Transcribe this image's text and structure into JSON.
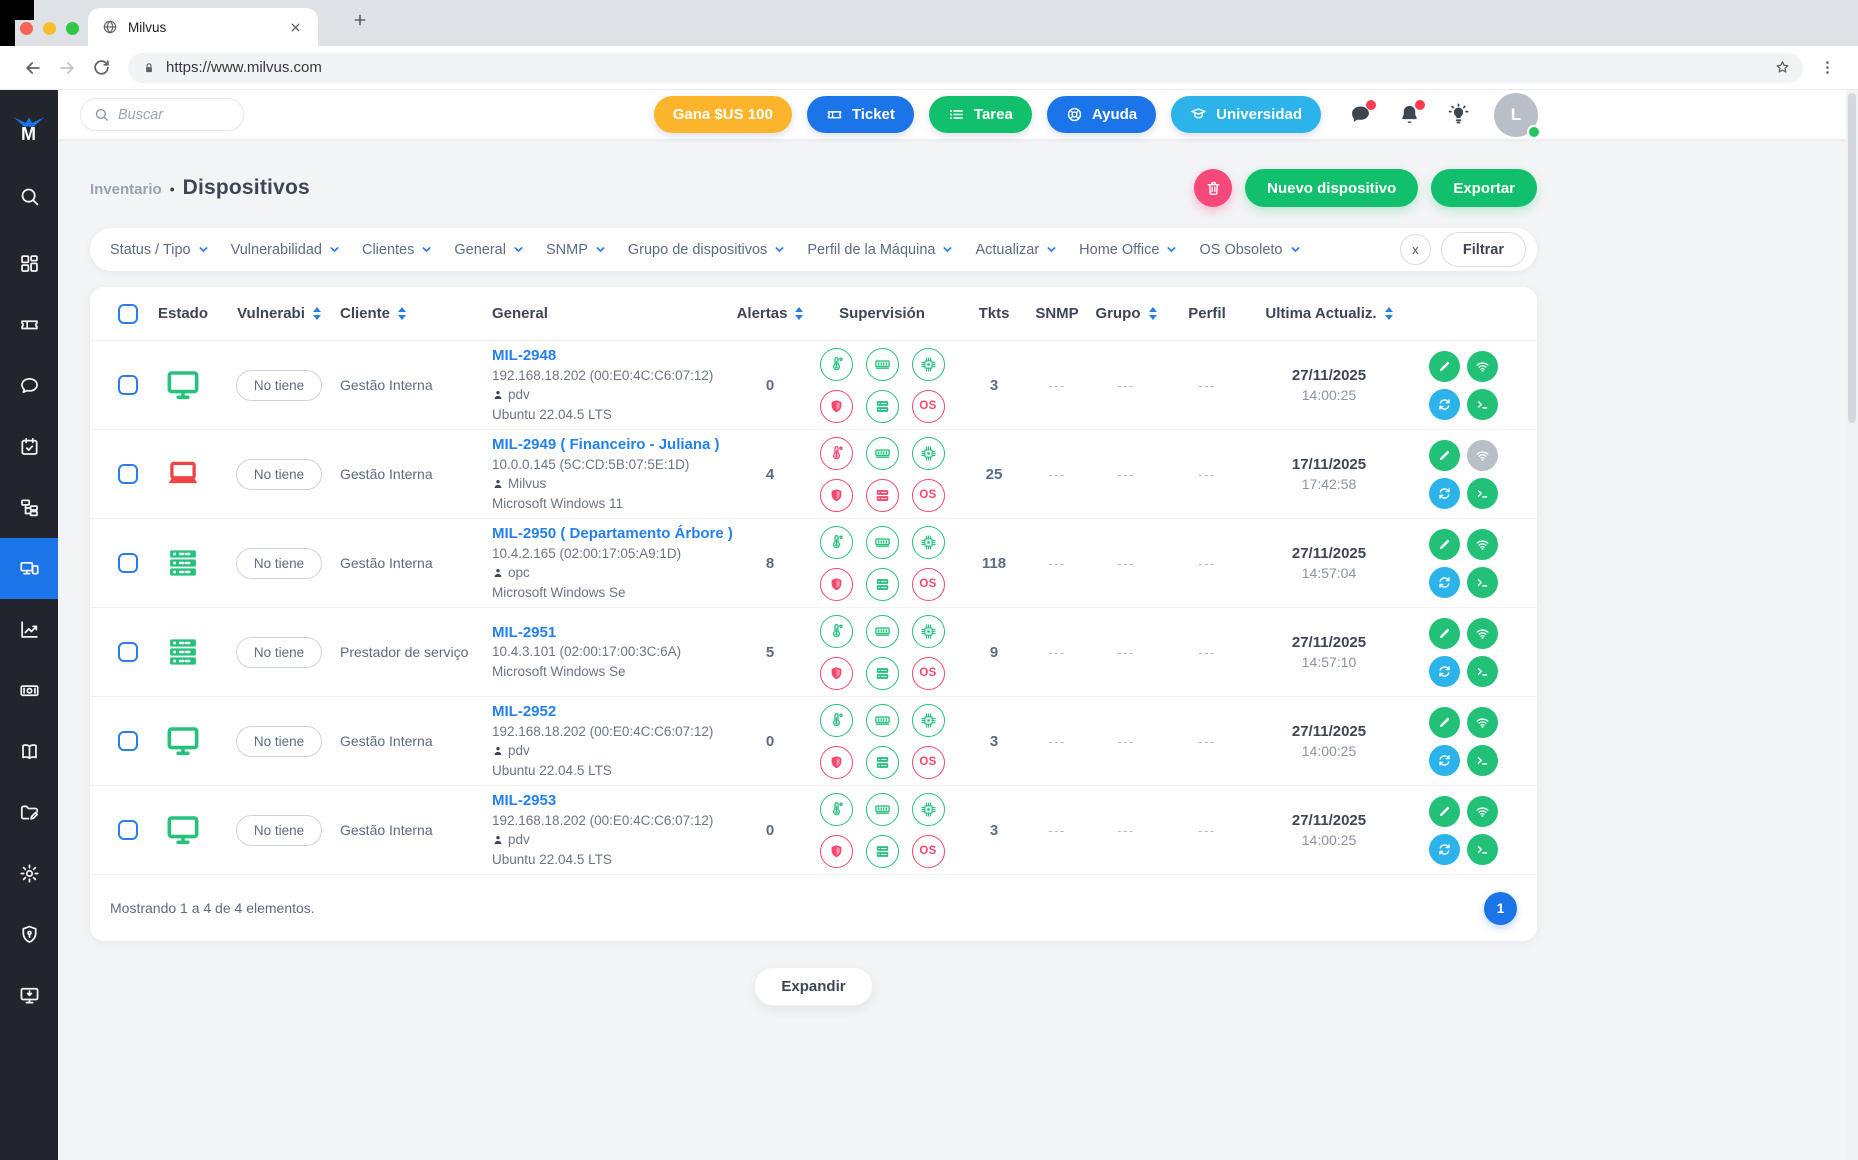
{
  "colors": {
    "green": "#12bf6c",
    "icon_green": "#27c17e",
    "pink": "#f5476e",
    "blue": "#1b74e8",
    "cyan": "#2bb3ea",
    "yellow": "#fbb42c",
    "laptop_red": "#ef4444",
    "sidebar_bg": "#22252b",
    "link_blue": "#2680eb",
    "notification_red": "#fb3c52"
  },
  "browser": {
    "tab_title": "Milvus",
    "url": "https://www.milvus.com"
  },
  "sidebar": {
    "active": "devices",
    "items": [
      {
        "name": "search"
      },
      {
        "name": "dashboard"
      },
      {
        "name": "tickets"
      },
      {
        "name": "chat"
      },
      {
        "name": "calendar"
      },
      {
        "name": "topology"
      },
      {
        "name": "devices"
      },
      {
        "name": "reports"
      },
      {
        "name": "billing"
      },
      {
        "name": "knowledge-base"
      },
      {
        "name": "projects"
      },
      {
        "name": "settings"
      },
      {
        "name": "security"
      },
      {
        "name": "remote-install"
      }
    ]
  },
  "topbar": {
    "search_placeholder": "Buscar",
    "pills": [
      {
        "id": "reward",
        "label": "Gana $US 100",
        "icon": null,
        "bg": "#fbb42c"
      },
      {
        "id": "ticket",
        "label": "Ticket",
        "icon": "ticket",
        "bg": "#1b74e8"
      },
      {
        "id": "task",
        "label": "Tarea",
        "icon": "list",
        "bg": "#12bf6c"
      },
      {
        "id": "help",
        "label": "Ayuda",
        "icon": "life-ring",
        "bg": "#1b74e8"
      },
      {
        "id": "university",
        "label": "Universidad",
        "icon": "graduation-cap",
        "bg": "#2bb3ea"
      }
    ],
    "avatar_initial": "L"
  },
  "page": {
    "breadcrumb": "Inventario",
    "separator": "•",
    "title": "Dispositivos",
    "new_device": "Nuevo dispositivo",
    "export": "Exportar"
  },
  "filters": {
    "items": [
      "Status / Tipo",
      "Vulnerabilidad",
      "Clientes",
      "General",
      "SNMP",
      "Grupo de dispositivos",
      "Perfil de la Máquina",
      "Actualizar",
      "Home Office",
      "OS Obsoleto"
    ],
    "clear": "x",
    "apply": "Filtrar"
  },
  "table": {
    "columns": [
      {
        "label": "Estado",
        "sortable": false,
        "align": "center"
      },
      {
        "label": "Vulnerabi",
        "sortable": true,
        "align": "center"
      },
      {
        "label": "Cliente",
        "sortable": true,
        "align": "left"
      },
      {
        "label": "General",
        "sortable": false,
        "align": "left"
      },
      {
        "label": "Alertas",
        "sortable": true,
        "align": "center"
      },
      {
        "label": "Supervisión",
        "sortable": false,
        "align": "center"
      },
      {
        "label": "Tkts",
        "sortable": false,
        "align": "center"
      },
      {
        "label": "SNMP",
        "sortable": false,
        "align": "center"
      },
      {
        "label": "Grupo",
        "sortable": true,
        "align": "center"
      },
      {
        "label": "Perfil",
        "sortable": false,
        "align": "center"
      },
      {
        "label": "Ultima Actualiz.",
        "sortable": true,
        "align": "center"
      }
    ],
    "rows": [
      {
        "device": "desktop",
        "vulnerability": "No tiene",
        "client": "Gestão Interna",
        "name": "MIL-2948",
        "network": "192.168.18.202 (00:E0:4C:C6:07:12)",
        "user": "pdv",
        "os": "Ubuntu 22.04.5 LTS",
        "alerts": "0",
        "supervision": {
          "temperature": "ok",
          "memory": "ok",
          "cpu": "ok",
          "antivirus": "alert",
          "disk": "ok",
          "os": "alert"
        },
        "tickets": "3",
        "snmp": "---",
        "group": "---",
        "profile": "---",
        "date": "27/11/2025",
        "time": "14:00:25",
        "connection": "online"
      },
      {
        "device": "laptop",
        "vulnerability": "No tiene",
        "client": "Gestão Interna",
        "name": "MIL-2949 ( Financeiro - Juliana )",
        "network": "10.0.0.145 (5C:CD:5B:07:5E:1D)",
        "user": "Milvus",
        "os": "Microsoft Windows 11",
        "alerts": "4",
        "supervision": {
          "temperature": "alert",
          "memory": "ok",
          "cpu": "ok",
          "antivirus": "alert",
          "disk": "alert",
          "os": "alert"
        },
        "tickets": "25",
        "snmp": "---",
        "group": "---",
        "profile": "---",
        "date": "17/11/2025",
        "time": "17:42:58",
        "connection": "offline"
      },
      {
        "device": "server",
        "vulnerability": "No tiene",
        "client": "Gestão Interna",
        "name": "MIL-2950 ( Departamento Árbore )",
        "network": "10.4.2.165 (02:00:17:05:A9:1D)",
        "user": "opc",
        "os": "Microsoft Windows Se",
        "alerts": "8",
        "supervision": {
          "temperature": "ok",
          "memory": "ok",
          "cpu": "ok",
          "antivirus": "alert",
          "disk": "ok",
          "os": "alert"
        },
        "tickets": "118",
        "snmp": "---",
        "group": "---",
        "profile": "---",
        "date": "27/11/2025",
        "time": "14:57:04",
        "connection": "online"
      },
      {
        "device": "server",
        "vulnerability": "No tiene",
        "client": "Prestador de serviço",
        "name": "MIL-2951",
        "network": "10.4.3.101 (02:00:17:00:3C:6A)",
        "user": null,
        "os": "Microsoft Windows Se",
        "alerts": "5",
        "supervision": {
          "temperature": "ok",
          "memory": "ok",
          "cpu": "ok",
          "antivirus": "alert",
          "disk": "ok",
          "os": "alert"
        },
        "tickets": "9",
        "snmp": "---",
        "group": "---",
        "profile": "---",
        "date": "27/11/2025",
        "time": "14:57:10",
        "connection": "online"
      },
      {
        "device": "desktop",
        "vulnerability": "No tiene",
        "client": "Gestão Interna",
        "name": "MIL-2952",
        "network": "192.168.18.202 (00:E0:4C:C6:07:12)",
        "user": "pdv",
        "os": "Ubuntu 22.04.5 LTS",
        "alerts": "0",
        "supervision": {
          "temperature": "ok",
          "memory": "ok",
          "cpu": "ok",
          "antivirus": "alert",
          "disk": "ok",
          "os": "alert"
        },
        "tickets": "3",
        "snmp": "---",
        "group": "---",
        "profile": "---",
        "date": "27/11/2025",
        "time": "14:00:25",
        "connection": "online"
      },
      {
        "device": "desktop",
        "vulnerability": "No tiene",
        "client": "Gestão Interna",
        "name": "MIL-2953",
        "network": "192.168.18.202 (00:E0:4C:C6:07:12)",
        "user": "pdv",
        "os": "Ubuntu 22.04.5 LTS",
        "alerts": "0",
        "supervision": {
          "temperature": "ok",
          "memory": "ok",
          "cpu": "ok",
          "antivirus": "alert",
          "disk": "ok",
          "os": "alert"
        },
        "tickets": "3",
        "snmp": "---",
        "group": "---",
        "profile": "---",
        "date": "27/11/2025",
        "time": "14:00:25",
        "connection": "online"
      }
    ],
    "summary": "Mostrando 1 a 4 de 4 elementos.",
    "page_number": "1"
  },
  "expand": "Expandir"
}
